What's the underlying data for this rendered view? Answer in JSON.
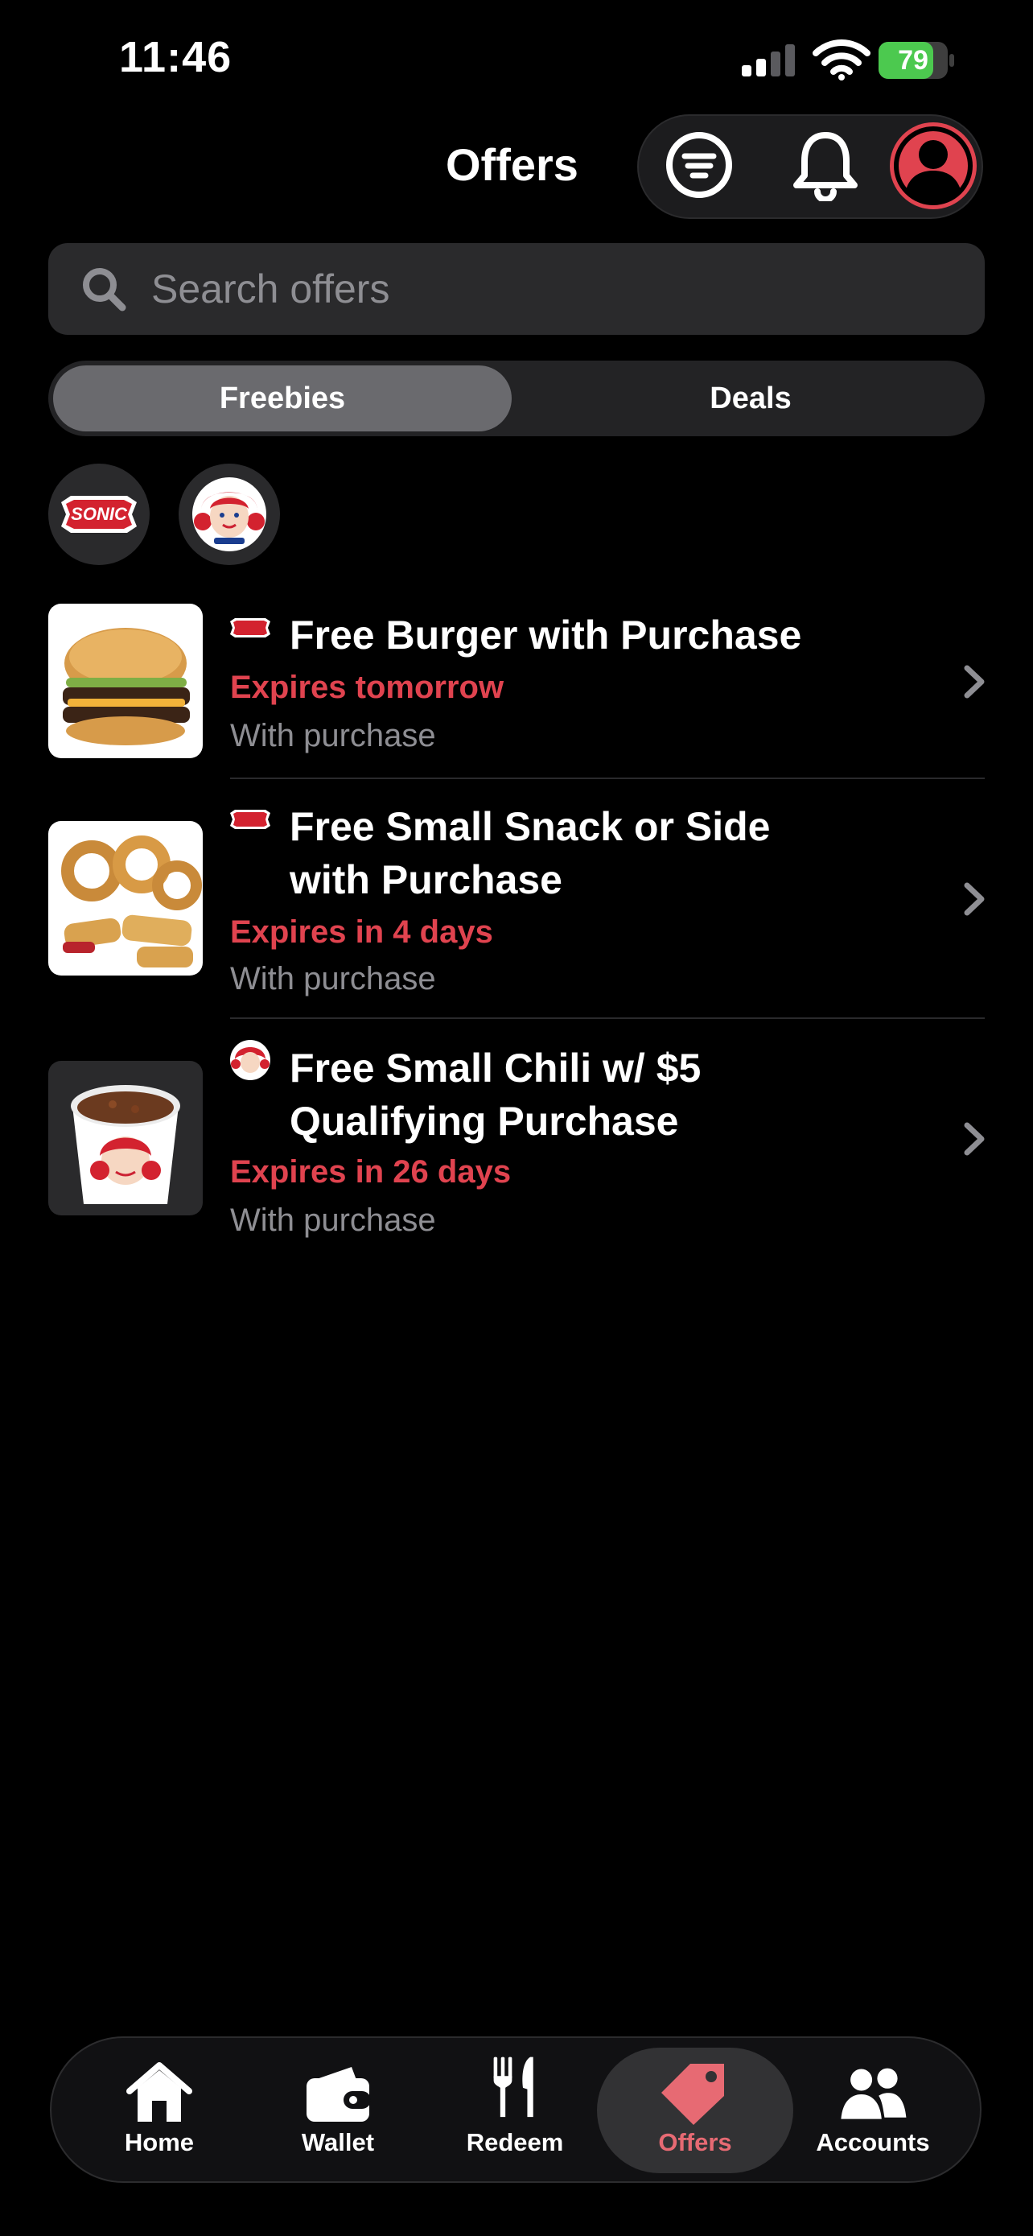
{
  "status_bar": {
    "time": "11:46",
    "battery_percent": "79",
    "battery_level": 0.79
  },
  "header": {
    "title": "Offers"
  },
  "search": {
    "placeholder": "Search offers"
  },
  "tabs": [
    {
      "label": "Freebies",
      "active": true
    },
    {
      "label": "Deals",
      "active": false
    }
  ],
  "brands": [
    {
      "name": "SONIC"
    },
    {
      "name": "Wendy's"
    }
  ],
  "offers": [
    {
      "brand": "SONIC",
      "title": "Free Burger with Purchase",
      "expiry": "Expires tomorrow",
      "note": "With purchase"
    },
    {
      "brand": "SONIC",
      "title_lines": [
        "Free Small Snack or Side",
        "with Purchase"
      ],
      "expiry": "Expires in 4 days",
      "note": "With purchase"
    },
    {
      "brand": "Wendy's",
      "title_lines": [
        "Free Small Chili w/ $5",
        "Qualifying Purchase"
      ],
      "expiry": "Expires in 26 days",
      "note": "With purchase"
    }
  ],
  "nav": {
    "items": [
      {
        "label": "Home",
        "icon": "home-icon"
      },
      {
        "label": "Wallet",
        "icon": "wallet-icon"
      },
      {
        "label": "Redeem",
        "icon": "fork-knife-icon"
      },
      {
        "label": "Offers",
        "icon": "tag-icon",
        "active": true
      },
      {
        "label": "Accounts",
        "icon": "people-icon"
      }
    ]
  },
  "colors": {
    "accent": "#e0434f",
    "battery": "#4cc94f",
    "background": "#000000"
  }
}
